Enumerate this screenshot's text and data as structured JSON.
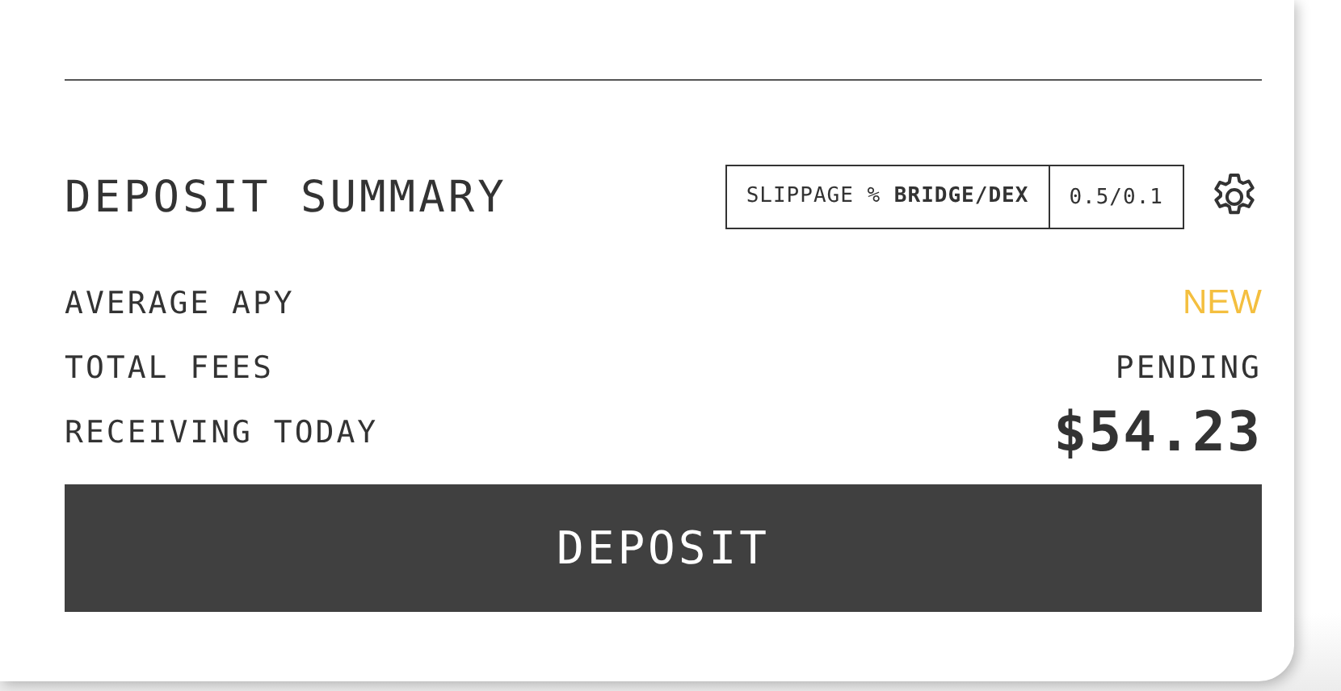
{
  "title": "DEPOSIT SUMMARY",
  "slippage": {
    "label": "SLIPPAGE % **BRIDGE/DEX**",
    "value": "0.5/0.1"
  },
  "rows": [
    {
      "label": "AVERAGE APY",
      "value": "NEW",
      "kind": "badge"
    },
    {
      "label": "TOTAL FEES",
      "value": "PENDING",
      "kind": "text"
    },
    {
      "label": "RECEIVING TODAY",
      "value": "$54.23",
      "kind": "amount"
    }
  ],
  "button": "DEPOSIT"
}
